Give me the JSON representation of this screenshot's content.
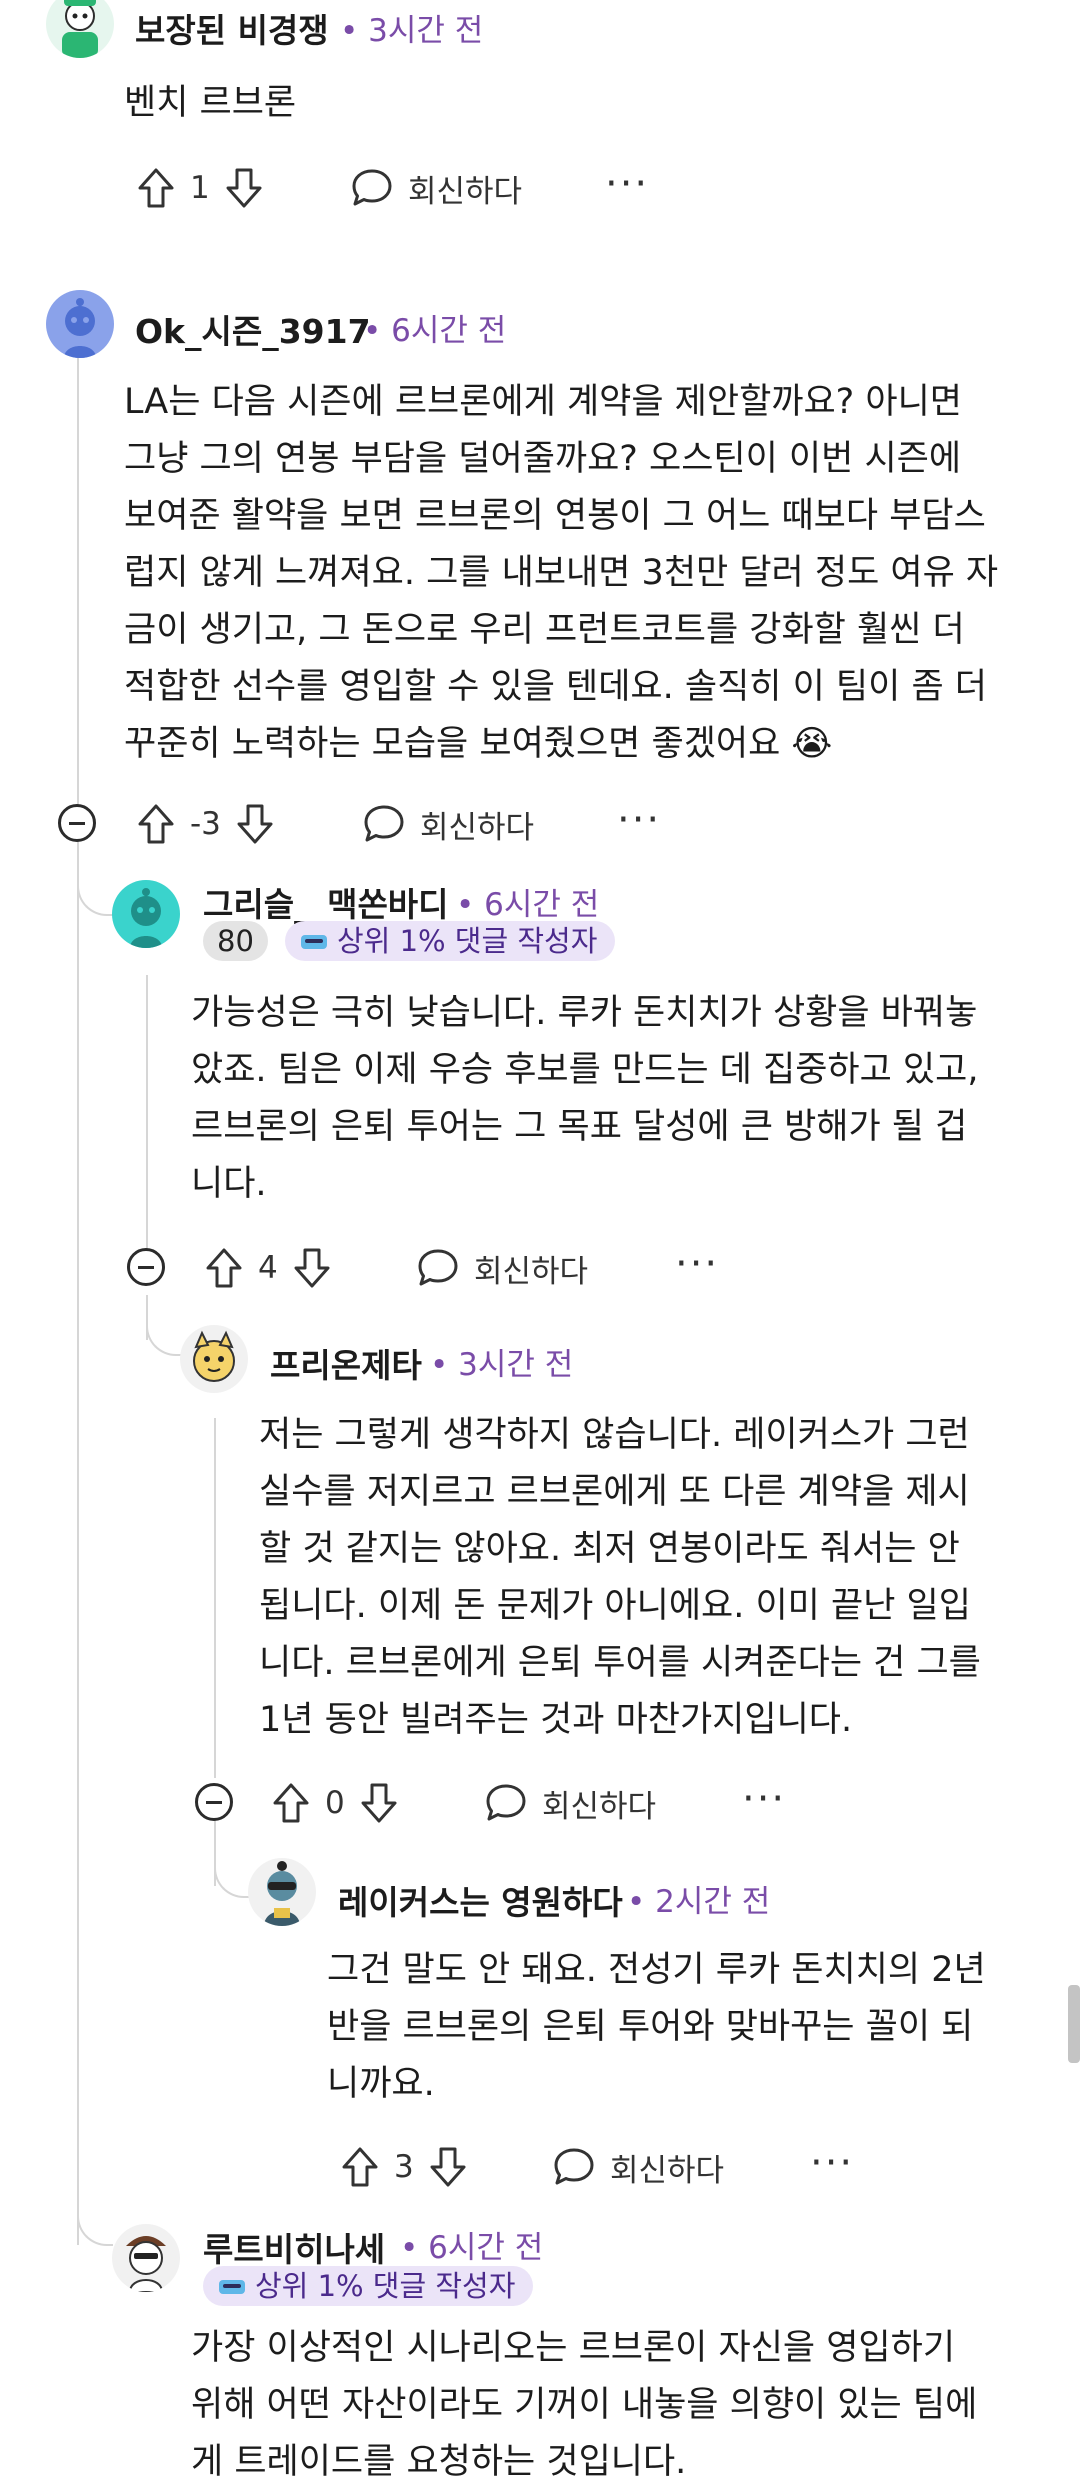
{
  "comments": [
    {
      "username": "보장된 비경쟁",
      "time": "3시간 전",
      "lines": [
        "벤치 르브론"
      ],
      "votes": "1",
      "reply_label": "회신하다",
      "more": "···"
    },
    {
      "username": "Ok_시즌_3917",
      "time": "6시간 전",
      "lines": [
        "LA는 다음 시즌에 르브론에게 계약을 제안할까요? 아니면",
        "그냥 그의 연봉 부담을 덜어줄까요? 오스틴이 이번 시즌에",
        "보여준 활약을 보면 르브론의 연봉이 그 어느 때보다 부담스",
        "럽지 않게 느껴져요. 그를 내보내면 3천만 달러 정도 여유 자",
        "금이 생기고, 그 돈으로 우리 프런트코트를 강화할 훨씬 더",
        "적합한 선수를 영입할 수 있을 텐데요. 솔직히 이 팀이 좀 더",
        "꾸준히 노력하는 모습을 보여줬으면 좋겠어요 😭"
      ],
      "votes": "-3",
      "reply_label": "회신하다",
      "more": "···"
    },
    {
      "username": "그리슬__맥쏜바디",
      "time": "6시간 전",
      "karma": "80",
      "top_badge": "상위 1% 댓글 작성자",
      "lines": [
        "가능성은 극히 낮습니다. 루카 돈치치가 상황을 바꿔놓",
        "았죠. 팀은 이제 우승 후보를 만드는 데 집중하고 있고,",
        "르브론의 은퇴 투어는 그 목표 달성에 큰 방해가 될 겁",
        "니다."
      ],
      "votes": "4",
      "reply_label": "회신하다",
      "more": "···"
    },
    {
      "username": "프리온제타",
      "time": "3시간 전",
      "lines": [
        "저는 그렇게 생각하지 않습니다. 레이커스가 그런",
        "실수를 저지르고 르브론에게 또 다른 계약을 제시",
        "할 것 같지는 않아요. 최저 연봉이라도 줘서는 안",
        "됩니다. 이제 돈 문제가 아니에요. 이미 끝난 일입",
        "니다. 르브론에게 은퇴 투어를 시켜준다는 건 그를",
        "1년 동안 빌려주는 것과 마찬가지입니다."
      ],
      "votes": "0",
      "reply_label": "회신하다",
      "more": "···"
    },
    {
      "username": "레이커스는 영원하다",
      "time": "2시간 전",
      "lines": [
        "그건 말도 안 돼요. 전성기 루카 돈치치의 2년",
        "반을 르브론의 은퇴 투어와 맞바꾸는 꼴이 되",
        "니까요."
      ],
      "votes": "3",
      "reply_label": "회신하다",
      "more": "···"
    },
    {
      "username": "루트비히나세",
      "time": "6시간 전",
      "top_badge": "상위 1% 댓글 작성자",
      "lines": [
        "가장 이상적인 시나리오는 르브론이 자신을 영입하기",
        "위해 어떤 자산이라도 기꺼이 내놓을 의향이 있는 팀에",
        "게 트레이드를 요청하는 것입니다."
      ]
    }
  ],
  "separator": "•",
  "colors": {
    "time": "#7a4ca8",
    "badge_bg": "#ebe4f8",
    "karma_bg": "#e4e4e4",
    "thread_line": "#d6d6d6"
  },
  "icons": [
    "upvote-icon",
    "downvote-icon",
    "reply-bubble-icon",
    "collapse-minus-icon",
    "more-dots-icon"
  ]
}
